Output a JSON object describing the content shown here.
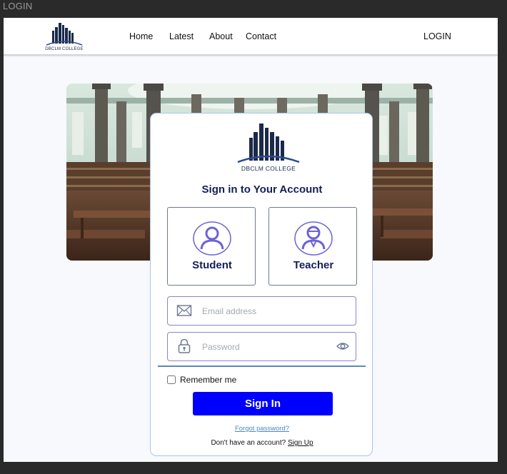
{
  "window": {
    "title": "LOGIN"
  },
  "nav": {
    "logo_text": "DBCLM COLLEGE",
    "links": [
      "Home",
      "Latest",
      "About",
      "Contact"
    ],
    "login": "LOGIN"
  },
  "card": {
    "logo_text": "DBCLM COLLEGE",
    "title": "Sign in to  Your Account",
    "roles": [
      {
        "label": "Student",
        "icon": "student-icon"
      },
      {
        "label": "Teacher",
        "icon": "teacher-icon"
      }
    ],
    "email": {
      "placeholder": "Email address",
      "value": ""
    },
    "password": {
      "placeholder": "Password",
      "value": ""
    },
    "remember_label": "Remember me",
    "remember_checked": false,
    "signin_label": "Sign In",
    "forgot_label": "Forgot password?",
    "signup_prompt": "Don't have an account?",
    "signup_label": "Sign Up"
  },
  "colors": {
    "accent": "#0000ff",
    "heading": "#141e5a",
    "icon_purple": "#6b63d6",
    "link": "#4e89c2"
  }
}
